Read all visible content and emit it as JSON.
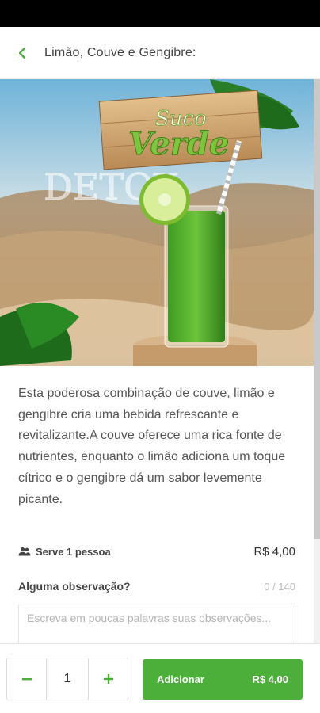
{
  "header": {
    "title": "Limão, Couve e Gengibre:"
  },
  "hero": {
    "sign_line1": "Suco",
    "sign_line2": "Verde",
    "side_text": "DETOX"
  },
  "product": {
    "description": "Esta poderosa combinação de couve, limão e gengibre cria uma bebida refrescante e revitalizante.A couve oferece uma rica fonte de nutrientes, enquanto o limão adiciona um toque cítrico e o gengibre dá um sabor levemente picante.",
    "serves": "Serve 1 pessoa",
    "price": "R$ 4,00"
  },
  "observation": {
    "label": "Alguma observação?",
    "counter": "0 / 140",
    "placeholder": "Escreva em poucas palavras suas observações...",
    "value": ""
  },
  "order": {
    "quantity": "1",
    "add_label": "Adicionar",
    "add_price": "R$ 4,00"
  },
  "colors": {
    "accent": "#4caf3a",
    "status_bar": "#000000"
  }
}
